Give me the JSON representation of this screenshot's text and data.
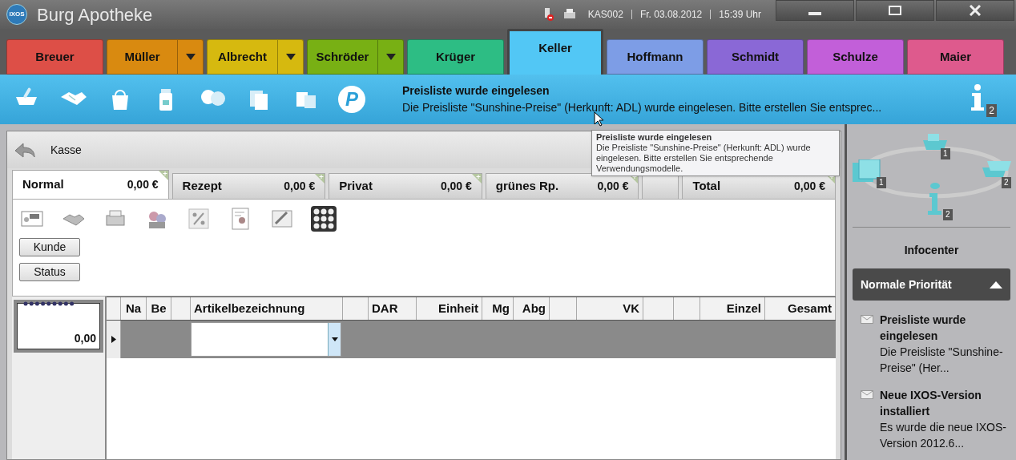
{
  "window": {
    "title": "Burg Apotheke",
    "logo": "IXOS",
    "station": "KAS002",
    "date": "Fr. 03.08.2012",
    "time": "15:39 Uhr"
  },
  "customer_tabs": [
    {
      "label": "Breuer",
      "color": "#dd4f47",
      "has_menu": false,
      "selected": false
    },
    {
      "label": "Müller",
      "color": "#d98a10",
      "has_menu": true,
      "selected": false
    },
    {
      "label": "Albrecht",
      "color": "#d6b90f",
      "has_menu": true,
      "selected": false
    },
    {
      "label": "Schröder",
      "color": "#78b014",
      "has_menu": true,
      "selected": false
    },
    {
      "label": "Krüger",
      "color": "#2dbd84",
      "has_menu": false,
      "selected": false
    },
    {
      "label": "Keller",
      "color": "#52c7f5",
      "has_menu": false,
      "selected": true
    },
    {
      "label": "Hoffmann",
      "color": "#7d9de6",
      "has_menu": false,
      "selected": false
    },
    {
      "label": "Schmidt",
      "color": "#8a68d6",
      "has_menu": false,
      "selected": false
    },
    {
      "label": "Schulze",
      "color": "#c25fd9",
      "has_menu": false,
      "selected": false
    },
    {
      "label": "Maier",
      "color": "#de5a8d",
      "has_menu": false,
      "selected": false
    }
  ],
  "toolbar": {
    "logo_letter": "P",
    "message_title": "Preisliste wurde eingelesen",
    "message_text": "Die Preisliste \"Sunshine-Preise\" (Herkunft: ADL) wurde eingelesen. Bitte erstellen Sie entsprec...",
    "info_count": "2"
  },
  "tooltip": {
    "title": "Preisliste wurde eingelesen",
    "text": "Die Preisliste \"Sunshine-Preise\" (Herkunft: ADL) wurde eingelesen. Bitte erstellen Sie entsprechende Verwendungsmodelle."
  },
  "panel": {
    "title": "Kasse",
    "tabs": [
      {
        "label": "Normal",
        "amount": "0,00 €",
        "selected": true
      },
      {
        "label": "Rezept",
        "amount": "0,00 €",
        "selected": false
      },
      {
        "label": "Privat",
        "amount": "0,00 €",
        "selected": false
      },
      {
        "label": "grünes Rp.",
        "amount": "0,00 €",
        "selected": false
      },
      {
        "selected": false
      },
      {
        "label": "Total",
        "amount": "0,00 €",
        "selected": false
      }
    ],
    "buttons": [
      "Kunde",
      "Status"
    ],
    "receipt_total": "0,00",
    "table": {
      "columns": [
        {
          "kind": "text",
          "label": "Na"
        },
        {
          "kind": "text",
          "label": "Be"
        },
        {
          "kind": "blank"
        },
        {
          "kind": "text",
          "label": "Artikelbezeichnung"
        },
        {
          "kind": "blank"
        },
        {
          "kind": "text",
          "label": "DAR"
        },
        {
          "kind": "text",
          "label": "Einheit"
        },
        {
          "kind": "text",
          "label": "Mg"
        },
        {
          "kind": "text",
          "label": "Abg"
        },
        {
          "kind": "blank"
        },
        {
          "kind": "text",
          "label": "VK"
        },
        {
          "kind": "blank"
        },
        {
          "kind": "blank"
        },
        {
          "kind": "text",
          "label": "Einzel"
        },
        {
          "kind": "text",
          "label": "Gesamt"
        }
      ]
    }
  },
  "infocenter": {
    "badges": [
      "1",
      "1",
      "2",
      "2"
    ],
    "title": "Infocenter",
    "group": "Normale Priorität",
    "expanded": true,
    "messages": [
      {
        "title": "Preisliste wurde eingelesen",
        "text": "Die Preisliste \"Sunshine-Preise\" (Her..."
      },
      {
        "title": "Neue IXOS-Version installiert",
        "text": "Es wurde die neue IXOS-Version 2012.6..."
      }
    ]
  }
}
